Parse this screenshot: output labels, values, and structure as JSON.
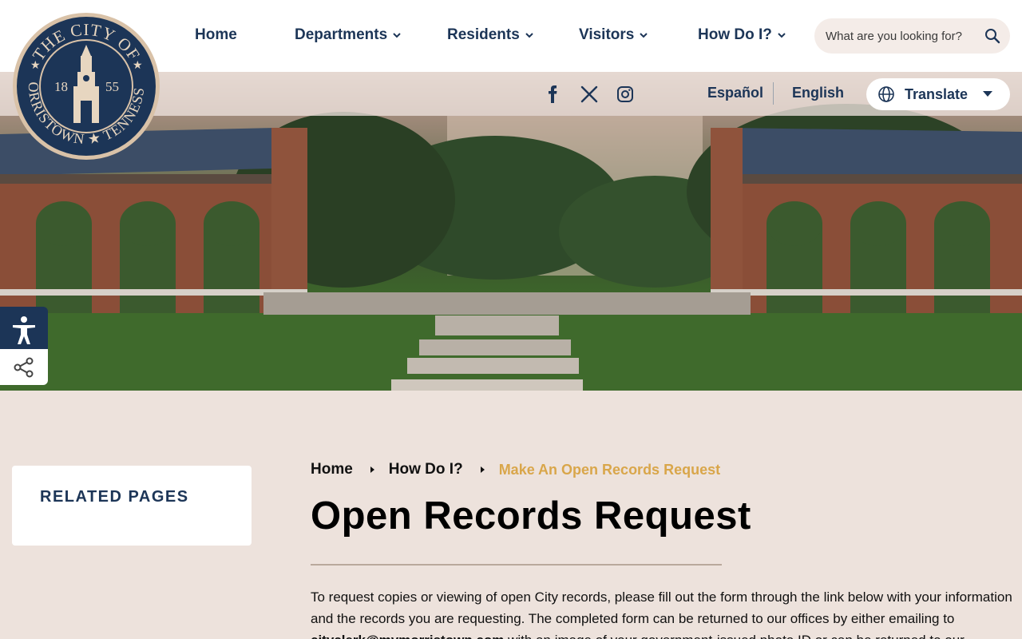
{
  "logo": {
    "top_text": "THE CITY OF",
    "left_year": "18",
    "right_year": "55",
    "bottom_text": "MORRISTOWN ★ TENNESSEE"
  },
  "nav": {
    "items": [
      {
        "label": "Home",
        "has_dropdown": false
      },
      {
        "label": "Departments",
        "has_dropdown": true
      },
      {
        "label": "Residents",
        "has_dropdown": true
      },
      {
        "label": "Visitors",
        "has_dropdown": true
      },
      {
        "label": "How Do I?",
        "has_dropdown": true
      }
    ]
  },
  "search": {
    "placeholder": "What are you looking for?",
    "icon": "search-icon"
  },
  "social": [
    {
      "name": "facebook-icon"
    },
    {
      "name": "x-icon"
    },
    {
      "name": "instagram-icon"
    }
  ],
  "languages": {
    "spanish": "Español",
    "english": "English"
  },
  "translate": {
    "label": "Translate",
    "icon": "globe-icon"
  },
  "sidebar": {
    "related_title": "RELATED PAGES"
  },
  "breadcrumb": {
    "items": [
      "Home",
      "How Do I?"
    ],
    "current": "Make An Open Records Request"
  },
  "main": {
    "title": "Open Records Request",
    "intro_part1": "To request copies or viewing of open City records, please fill out the form through the link below with your information and the records you are requesting. The completed form can be returned to our offices by either emailing to ",
    "intro_email": "cityclerk@mymorristown.com",
    "intro_part2": " with an image of your government-issued photo ID or can be returned to our"
  },
  "colors": {
    "navy": "#1c3557",
    "gold": "#d9a64a",
    "page_bg": "#ede2dc"
  }
}
